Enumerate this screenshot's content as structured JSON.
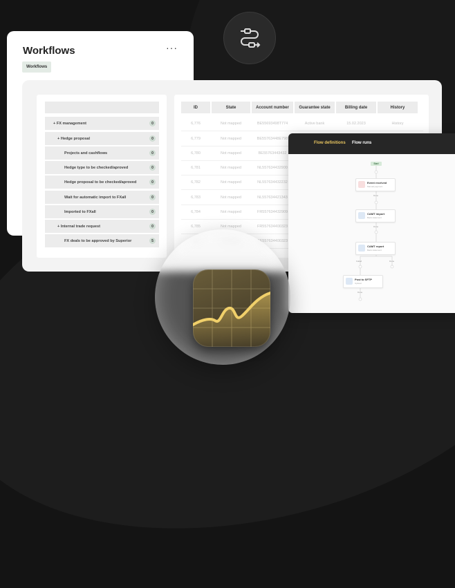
{
  "workflows_card": {
    "title": "Workflows",
    "more_label": "···",
    "chip": "Workflows"
  },
  "tree": {
    "items": [
      {
        "label": "+ FX management",
        "count": "0"
      },
      {
        "label": "+ Hedge proposal",
        "count": "0"
      },
      {
        "label": "Projects and cashflows",
        "count": "0"
      },
      {
        "label": "Hedge type to be checked/aproved",
        "count": "0"
      },
      {
        "label": "Hedge proposal to be checked/aproved",
        "count": "0"
      },
      {
        "label": "Wait for automatic import to FXall",
        "count": "0"
      },
      {
        "label": "Imported to FXall",
        "count": "0"
      },
      {
        "label": "+ Internal trade request",
        "count": "0"
      },
      {
        "label": "FX deals to be approved by Superior",
        "count": "5"
      }
    ]
  },
  "table": {
    "headers": [
      "ID",
      "State",
      "Account number",
      "Guarantee state",
      "Billing date",
      "History"
    ],
    "rows": [
      [
        "6,776",
        "Not mapped",
        "BE55693498T774",
        "Active bank",
        "15.02.2023",
        "History"
      ],
      [
        "6,779",
        "Not mapped",
        "BE55763448E798",
        "",
        "",
        ""
      ],
      [
        "6,780",
        "Not mapped",
        "BE55763443432",
        "",
        "",
        ""
      ],
      [
        "6,781",
        "Not mapped",
        "NL557634432900",
        "",
        "",
        ""
      ],
      [
        "6,782",
        "Not mapped",
        "NL557634432232",
        "",
        "",
        ""
      ],
      [
        "6,783",
        "Not mapped",
        "NL557634421343",
        "",
        "",
        ""
      ],
      [
        "6,784",
        "Not mapped",
        "FR557634432909",
        "",
        "",
        ""
      ],
      [
        "6,785",
        "Not mapped",
        "FR557634400323",
        "",
        "",
        ""
      ],
      [
        "6,786",
        "Not mapped",
        "BE557634400323",
        "",
        "",
        ""
      ]
    ]
  },
  "flow": {
    "tabs": [
      "Flow definitions",
      "Flow runs"
    ],
    "start": "Start",
    "nodes": [
      {
        "title": "Event received",
        "sub": "Manual payment"
      },
      {
        "title": "CAMT import",
        "sub": "Bank statement"
      },
      {
        "title": "CAMT report",
        "sub": "Bank statement"
      },
      {
        "title": "Post to SFTP",
        "sub": "Upload"
      }
    ],
    "labels": [
      "Done",
      "Done",
      "Failed",
      "Done",
      "Done"
    ],
    "accent": "#e8c560"
  },
  "icons": {
    "top": "flow-arrows-icon",
    "center": "area-chart-icon"
  }
}
